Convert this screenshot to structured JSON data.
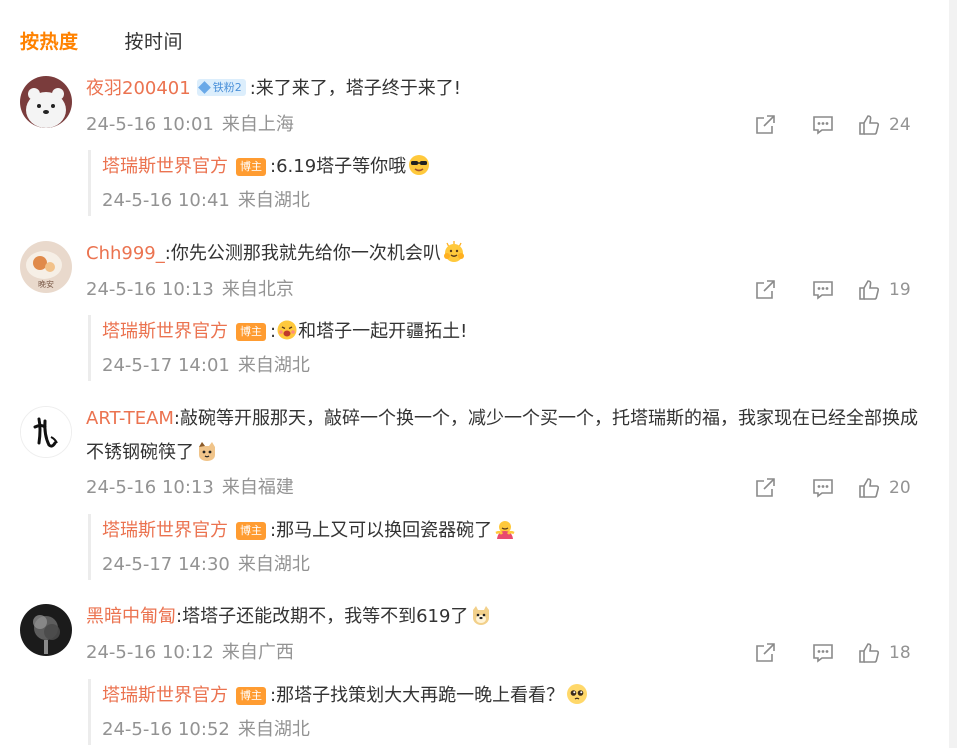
{
  "tabs": {
    "hot": "按热度",
    "time": "按时间"
  },
  "colors": {
    "accent": "#ff8200",
    "username": "#eb7350",
    "meta": "#939393",
    "host_badge": "#ff9c31"
  },
  "comments": [
    {
      "user": "夜羽200401",
      "badge": "铁粉2",
      "text": ":来了来了，塔子终于来了!",
      "date": "24-5-16 10:01",
      "location": "来自上海",
      "likes": "24",
      "avatar_icon": "polar-bear-avatar",
      "reply": {
        "user": "塔瑞斯世界官方",
        "badge": "博主",
        "text": ":6.19塔子等你哦",
        "emoji": "sunglasses-emoji",
        "date": "24-5-16 10:41",
        "location": "来自湖北"
      }
    },
    {
      "user": "Chh999_",
      "text": ":你先公测那我就先给你一次机会叭",
      "emoji": "hug-emoji",
      "date": "24-5-16 10:13",
      "location": "来自北京",
      "likes": "19",
      "avatar_icon": "food-photo-avatar",
      "avatar_text": "晚安",
      "reply": {
        "user": "塔瑞斯世界官方",
        "badge": "博主",
        "text": "和塔子一起开疆拓土!",
        "lead": ":",
        "lead_emoji": "cheer-emoji",
        "date": "24-5-17 14:01",
        "location": "来自湖北"
      }
    },
    {
      "user": "ART-TEAM",
      "text": ":敲碗等开服那天，敲碎一个换一个，减少一个买一个，托塔瑞斯的福，我家现在已经全部换成不锈钢碗筷了",
      "emoji": "cat-emoji",
      "date": "24-5-16 10:13",
      "location": "来自福建",
      "likes": "20",
      "avatar_icon": "calligraphy-avatar",
      "reply": {
        "user": "塔瑞斯世界官方",
        "badge": "博主",
        "text": ":那马上又可以换回瓷器碗了",
        "emoji": "hug-person-emoji",
        "date": "24-5-17 14:30",
        "location": "来自湖北"
      }
    },
    {
      "user": "黑暗中匍匐",
      "text": ":塔塔子还能改期不，我等不到619了",
      "emoji": "doge-emoji",
      "date": "24-5-16 10:12",
      "location": "来自广西",
      "likes": "18",
      "avatar_icon": "smoke-avatar",
      "reply": {
        "user": "塔瑞斯世界官方",
        "badge": "博主",
        "text": ":那塔子找策划大大再跪一晚上看看？",
        "emoji": "pleading-emoji",
        "date": "24-5-16 10:52",
        "location": "来自湖北"
      }
    }
  ]
}
